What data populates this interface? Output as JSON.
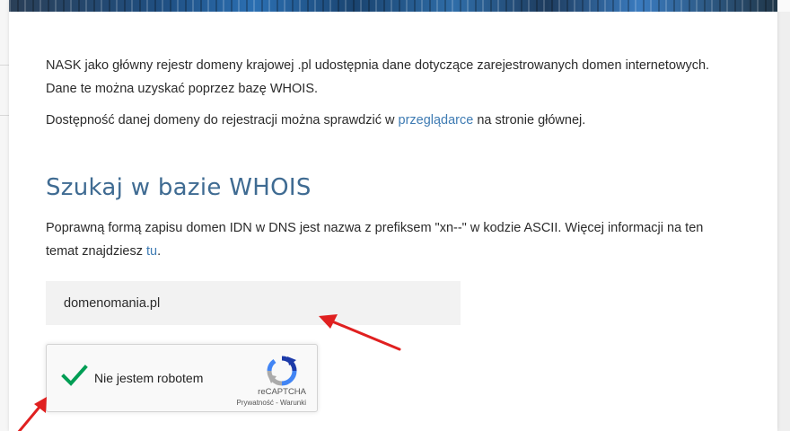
{
  "intro": {
    "line1": "NASK jako główny rejestr domeny krajowej .pl udostępnia dane dotyczące zarejestrowanych domen internetowych.",
    "line2": "Dane te można uzyskać poprzez bazę WHOIS.",
    "availability_before": "Dostępność danej domeny do rejestracji można sprawdzić w ",
    "availability_link": "przeglądarce",
    "availability_after": " na stronie głównej."
  },
  "whois": {
    "heading": "Szukaj w bazie WHOIS",
    "info_line1": "Poprawną formą zapisu domen IDN w DNS jest nazwa z prefiksem \"xn--\" w kodzie ASCII. Więcej informacji na ten",
    "info_line2_before": "temat znajdziesz ",
    "info_link": "tu",
    "info_line2_after": ".",
    "domain_value": "domenomania.pl"
  },
  "recaptcha": {
    "label": "Nie jestem robotem",
    "brand": "reCAPTCHA",
    "privacy": "Prywatność",
    "separator": " - ",
    "terms": "Warunki",
    "checked": true
  },
  "colors": {
    "link": "#3e7bb3",
    "heading": "#3f6b92",
    "check": "#009e55",
    "annotation_arrow": "#e02020"
  },
  "icons": [
    "checkmark-icon",
    "recaptcha-logo-icon",
    "annotation-arrow-icon"
  ]
}
